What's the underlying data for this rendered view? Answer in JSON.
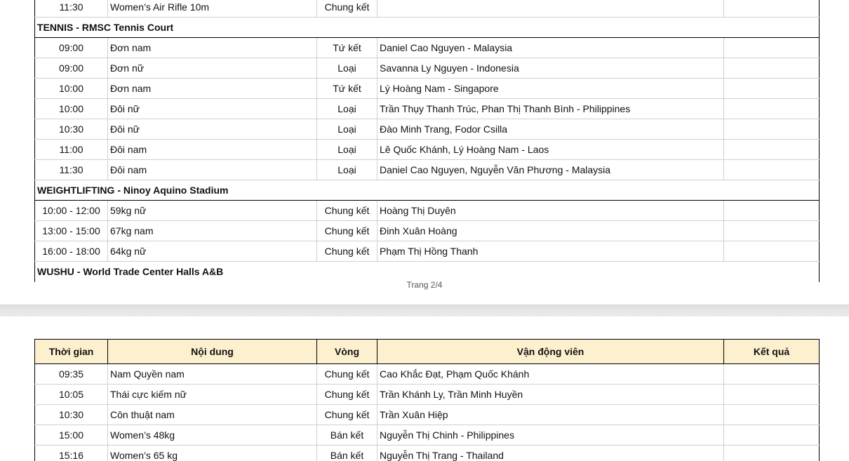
{
  "page1": {
    "rows_top": [
      {
        "time": "11:30",
        "event": "Women’s Air Rifle 10m",
        "round": "Chung kết",
        "athlete": "",
        "result": ""
      }
    ],
    "sections": [
      {
        "title": "TENNIS - RMSC Tennis Court",
        "rows": [
          {
            "time": "09:00",
            "event": "Đơn nam",
            "round": "Tứ kết",
            "athlete": "Daniel Cao Nguyen - Malaysia",
            "result": ""
          },
          {
            "time": "09:00",
            "event": "Đơn nữ",
            "round": "Loại",
            "athlete": "Savanna Ly Nguyen - Indonesia",
            "result": ""
          },
          {
            "time": "10:00",
            "event": "Đơn nam",
            "round": "Tứ kết",
            "athlete": "Lý Hoàng Nam - Singapore",
            "result": ""
          },
          {
            "time": "10:00",
            "event": "Đôi nữ",
            "round": "Loại",
            "athlete": "Trần Thụy Thanh Trúc, Phan Thị Thanh Bình - Philippines",
            "result": ""
          },
          {
            "time": "10:30",
            "event": "Đôi nữ",
            "round": "Loại",
            "athlete": "Đào Minh Trang, Fodor Csilla",
            "result": ""
          },
          {
            "time": "11:00",
            "event": "Đôi nam",
            "round": "Loại",
            "athlete": "Lê Quốc Khánh, Lý Hoàng Nam - Laos",
            "result": ""
          },
          {
            "time": "11:30",
            "event": "Đôi nam",
            "round": "Loại",
            "athlete": "Daniel Cao Nguyen, Nguyễn Văn Phương - Malaysia",
            "result": ""
          }
        ]
      },
      {
        "title": "WEIGHTLIFTING - Ninoy Aquino Stadium",
        "rows": [
          {
            "time": "10:00 - 12:00",
            "event": "59kg nữ",
            "round": "Chung kết",
            "athlete": "Hoàng Thị Duyên",
            "result": ""
          },
          {
            "time": "13:00 - 15:00",
            "event": "67kg nam",
            "round": "Chung kết",
            "athlete": "Đinh Xuân Hoàng",
            "result": ""
          },
          {
            "time": "16:00 - 18:00",
            "event": "64kg nữ",
            "round": "Chung kết",
            "athlete": "Phạm Thị Hồng Thanh",
            "result": ""
          }
        ]
      },
      {
        "title": "WUSHU - World Trade Center Halls A&B",
        "rows": []
      }
    ],
    "page_label": "Trang 2/4"
  },
  "page2": {
    "headers": {
      "time": "Thời gian",
      "event": "Nội dung",
      "round": "Vòng",
      "athlete": "Vận động viên",
      "result": "Kết quả"
    },
    "rows": [
      {
        "time": "09:35",
        "event": "Nam Quyền nam",
        "round": "Chung kết",
        "athlete": "Cao Khắc Đạt, Phạm Quốc Khánh",
        "result": ""
      },
      {
        "time": "10:05",
        "event": "Thái cực kiếm nữ",
        "round": "Chung kết",
        "athlete": "Trần Khánh Ly, Trần Minh Huyền",
        "result": ""
      },
      {
        "time": "10:30",
        "event": "Côn thuật nam",
        "round": "Chung kết",
        "athlete": "Trần Xuân Hiệp",
        "result": ""
      },
      {
        "time": "15:00",
        "event": "Women’s 48kg",
        "round": "Bán kết",
        "athlete": "Nguyễn Thị Chinh - Philippines",
        "result": ""
      },
      {
        "time": "15:16",
        "event": "Women’s 65 kg",
        "round": "Bán kết",
        "athlete": "Nguyễn Thị Trang - Thailand",
        "result": ""
      }
    ]
  }
}
